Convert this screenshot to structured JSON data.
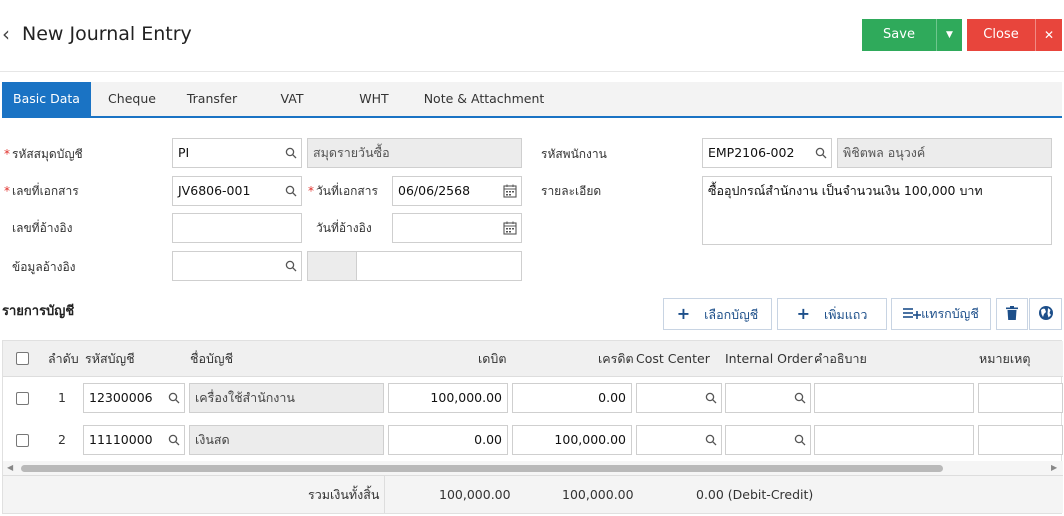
{
  "header": {
    "title": "New Journal Entry",
    "save_label": "Save",
    "close_label": "Close"
  },
  "tabs": [
    {
      "label": "Basic Data",
      "active": true
    },
    {
      "label": "Cheque"
    },
    {
      "label": "Transfer"
    },
    {
      "label": "VAT"
    },
    {
      "label": "WHT"
    },
    {
      "label": "Note & Attachment"
    }
  ],
  "form": {
    "book_code_label": "รหัสสมุดบัญชี",
    "book_code_value": "PI",
    "book_name_value": "สมุดรายวันซื้อ",
    "doc_no_label": "เลขที่เอกสาร",
    "doc_no_value": "JV6806-001",
    "doc_date_label": "วันที่เอกสาร",
    "doc_date_value": "06/06/2568",
    "ref_no_label": "เลขที่อ้างอิง",
    "ref_date_label": "วันที่อ้างอิง",
    "ref_info_label": "ข้อมูลอ้างอิง",
    "employee_label": "รหัสพนักงาน",
    "employee_code": "EMP2106-002",
    "employee_name": "พิชิตพล อนุวงค์",
    "detail_label": "รายละเอียด",
    "detail_value": "ซื้ออุปกรณ์สำนักงาน เป็นจำนวนเงิน 100,000 บาท"
  },
  "accounts": {
    "section_title": "รายการบัญชี",
    "btn_select_account": "เลือกบัญชี",
    "btn_add_row": "เพิ่มแถว",
    "btn_insert_account": "แทรกบัญชี",
    "columns": {
      "seq": "ลำดับ",
      "acc_code": "รหัสบัญชี",
      "acc_name": "ชื่อบัญชี",
      "debit": "เดบิต",
      "credit": "เครดิต",
      "cost_center": "Cost Center",
      "internal_order": "Internal Order",
      "description": "คำอธิบาย",
      "remark": "หมายเหตุ"
    },
    "rows": [
      {
        "seq": "1",
        "acc_code": "12300006",
        "acc_name": "เครื่องใช้สำนักงาน",
        "debit": "100,000.00",
        "credit": "0.00"
      },
      {
        "seq": "2",
        "acc_code": "11110000",
        "acc_name": "เงินสด",
        "debit": "0.00",
        "credit": "100,000.00"
      }
    ],
    "total_label": "รวมเงินทั้งสิ้น",
    "total_debit": "100,000.00",
    "total_credit": "100,000.00",
    "diff": "0.00 (Debit-Credit)"
  }
}
